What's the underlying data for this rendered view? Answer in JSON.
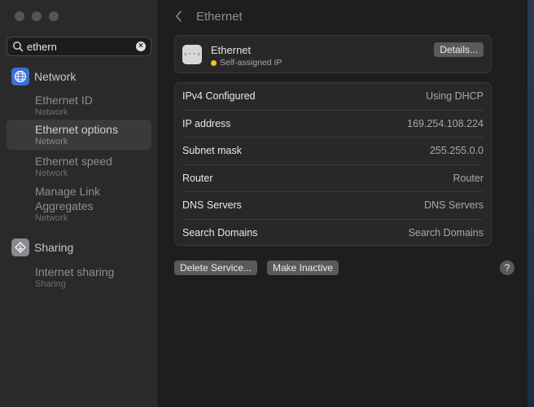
{
  "sidebar": {
    "search": {
      "value": "ethern"
    },
    "network": {
      "label": "Network",
      "icon": "globe-icon",
      "items": [
        {
          "title": "Ethernet ID",
          "subtitle": "Network"
        },
        {
          "title": "Ethernet options",
          "subtitle": "Network"
        },
        {
          "title": "Ethernet speed",
          "subtitle": "Network"
        },
        {
          "title": "Manage Link",
          "title2": "Aggregates",
          "subtitle": "Network"
        }
      ]
    },
    "sharing": {
      "label": "Sharing",
      "icon": "sharing-icon",
      "items": [
        {
          "title": "Internet sharing",
          "subtitle": "Sharing"
        }
      ]
    }
  },
  "main": {
    "title": "Ethernet",
    "service": {
      "name": "Ethernet",
      "status": "Self-assigned IP",
      "status_color": "#f0c32a",
      "details_label": "Details..."
    },
    "rows": [
      {
        "key": "IPv4 Configured",
        "value": "Using DHCP"
      },
      {
        "key": "IP address",
        "value": "169.254.108.224"
      },
      {
        "key": "Subnet mask",
        "value": "255.255.0.0"
      },
      {
        "key": "Router",
        "value": "Router"
      },
      {
        "key": "DNS Servers",
        "value": "DNS Servers"
      },
      {
        "key": "Search Domains",
        "value": "Search Domains"
      }
    ],
    "buttons": {
      "delete": "Delete Service...",
      "inactive": "Make Inactive",
      "help": "?"
    }
  },
  "colors": {
    "accent": "#3a6fd6",
    "selected": "#3a3a3d",
    "background": "#1e1e20"
  }
}
